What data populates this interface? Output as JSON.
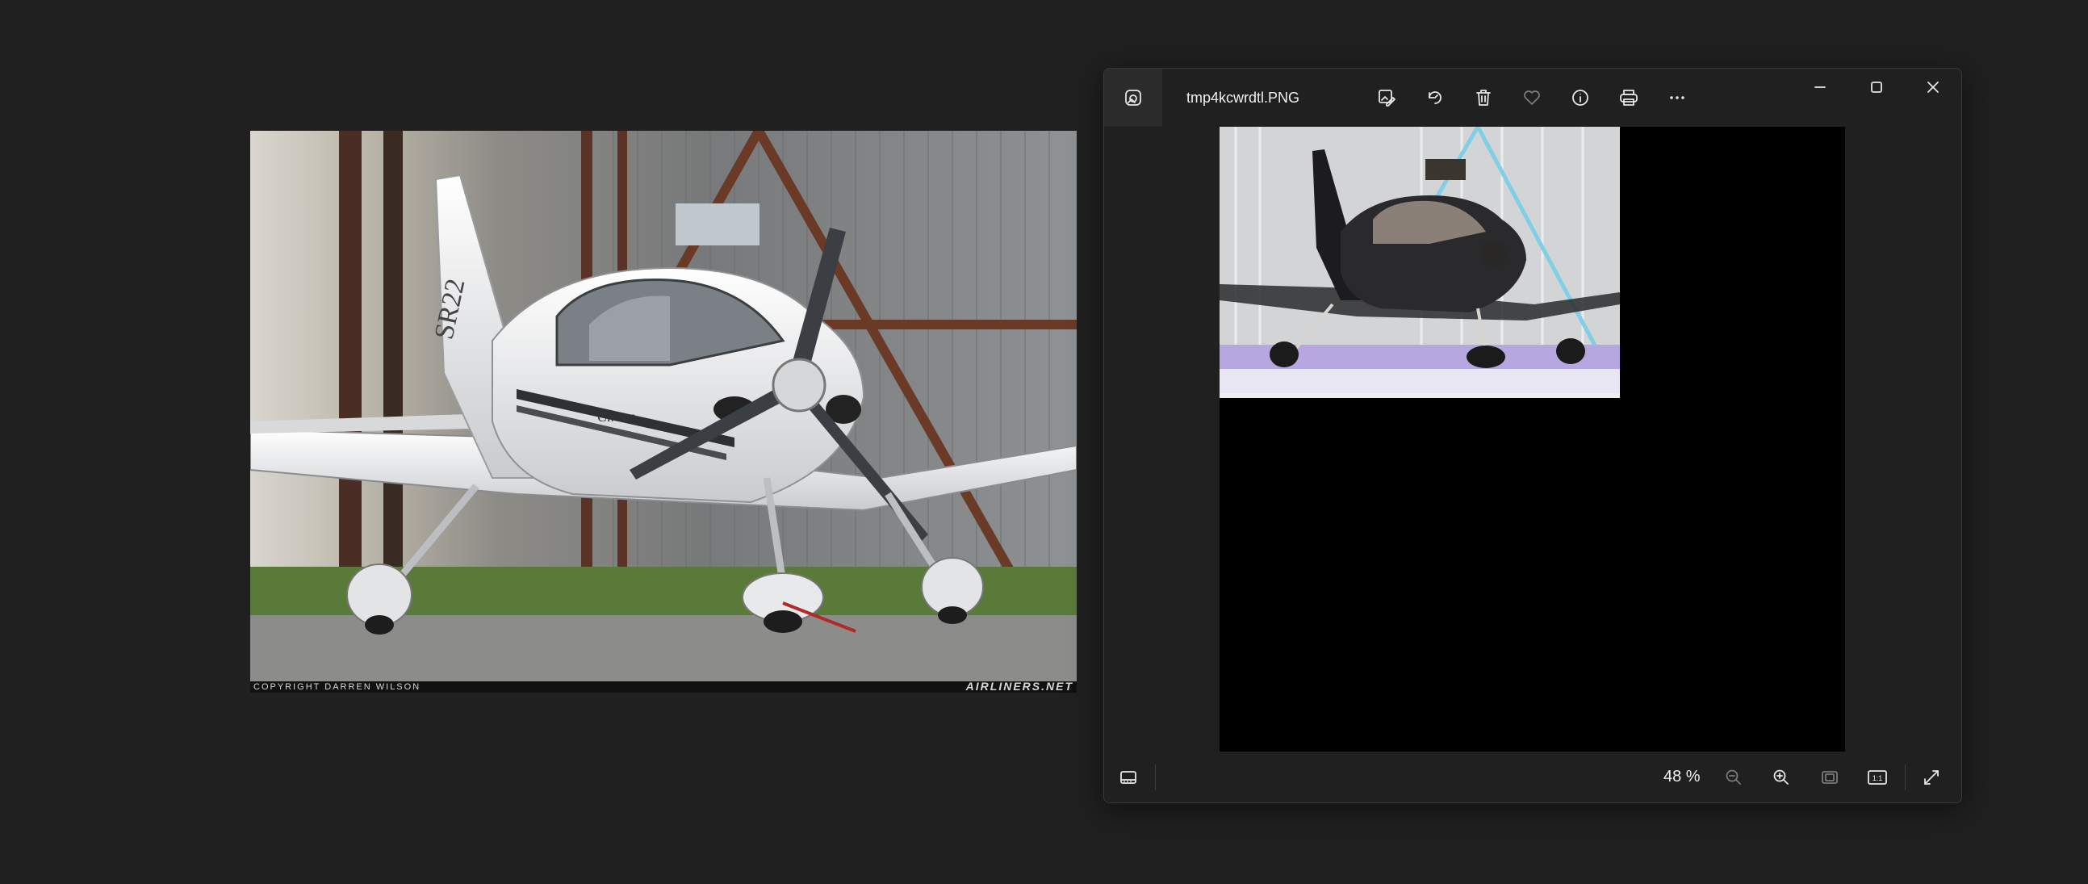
{
  "desktop": {
    "photo": {
      "caption_left": "COPYRIGHT DARREN WILSON",
      "caption_right": "AIRLINERS.NET",
      "tail_text": "SR22",
      "fuselage_text": "Cirrus"
    }
  },
  "viewer": {
    "file_name": "tmp4kcwrdtl.PNG",
    "toolbar": {
      "edit_icon": "edit-image-icon",
      "rotate_icon": "rotate-icon",
      "delete_icon": "delete-icon",
      "favorite_icon": "heart-icon",
      "info_icon": "info-icon",
      "print_icon": "print-icon",
      "more_icon": "more-icon"
    },
    "window_controls": {
      "minimize_icon": "minimize-icon",
      "maximize_icon": "maximize-icon",
      "close_icon": "close-icon"
    },
    "footer": {
      "filmstrip_icon": "filmstrip-icon",
      "zoom_label": "48 %",
      "zoom_out_icon": "zoom-out-icon",
      "zoom_in_icon": "zoom-in-icon",
      "fit_icon": "fit-to-window-icon",
      "actual_size_label": "1:1",
      "fullscreen_icon": "fullscreen-icon"
    }
  }
}
